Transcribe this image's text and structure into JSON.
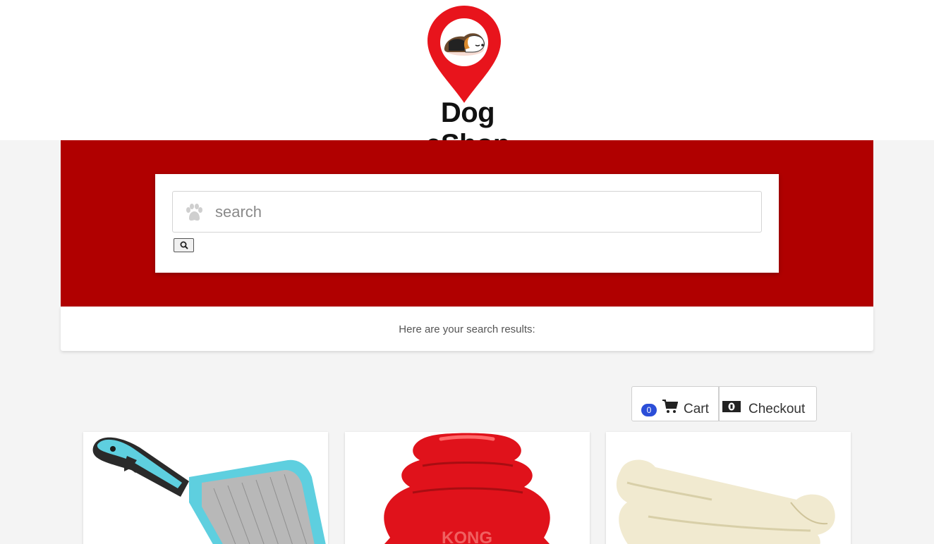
{
  "header": {
    "logo_text": "Dog eShop",
    "logo_icon": "map-pin-dog-icon"
  },
  "search": {
    "placeholder": "search",
    "value": "",
    "input_icon": "paw-icon",
    "button_icon": "magnifier-icon"
  },
  "results": {
    "heading": "Here are your search results:"
  },
  "cart": {
    "count": "0",
    "label": "Cart",
    "icon": "shopping-cart-icon"
  },
  "checkout": {
    "label": "Checkout",
    "icon": "money-bill-icon"
  },
  "products": [
    {
      "name": "slicker-brush",
      "icon": "brush-image"
    },
    {
      "name": "kong-toy",
      "image_text": "KONG",
      "icon": "kong-image"
    },
    {
      "name": "rawhide-bone",
      "icon": "bone-image"
    }
  ],
  "colors": {
    "brand_red": "#b00000",
    "badge_blue": "#2b4ed8",
    "pin_red": "#e8141c"
  }
}
